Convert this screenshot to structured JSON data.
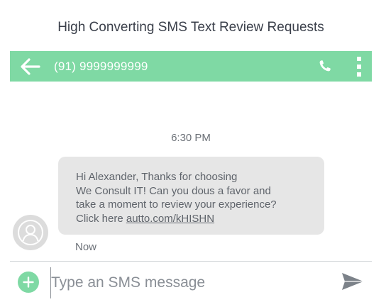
{
  "page_title": "High Converting SMS Text Review Requests",
  "header": {
    "contact_number": "(91) 9999999999",
    "icons": {
      "back": "arrow-left-icon",
      "call": "phone-icon",
      "menu": "more-vertical-icon"
    }
  },
  "conversation": {
    "timestamp": "6:30 PM",
    "message": {
      "lines": [
        "Hi Alexander, Thanks for choosing",
        "We Consult IT! Can you dous a favor and",
        "take a moment to review your experience?"
      ],
      "link_prefix": "Click here ",
      "link_text": "autto.com/kHISHN",
      "sent_time": "Now"
    },
    "avatar_icon": "user-avatar-icon"
  },
  "composer": {
    "placeholder": "Type an SMS message",
    "value": "",
    "add_icon": "plus-icon",
    "send_icon": "send-icon"
  },
  "colors": {
    "accent": "#7fd9a4",
    "bubble": "#e6e6e6",
    "text": "#5f646b",
    "title": "#3a3f4a"
  }
}
